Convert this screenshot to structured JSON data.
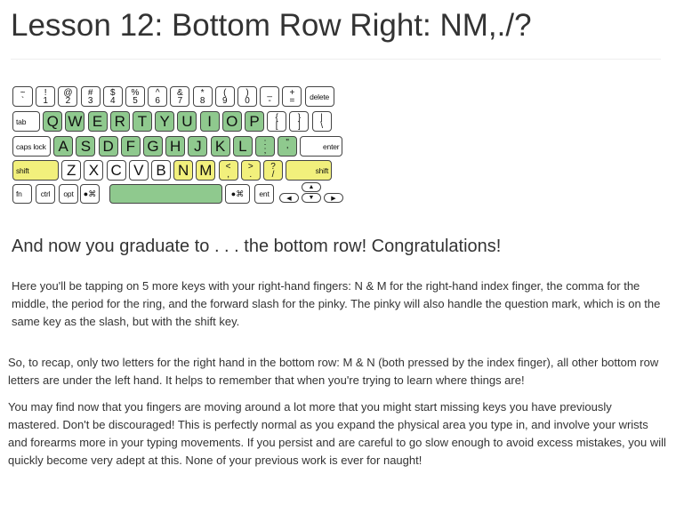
{
  "lesson": {
    "title": "Lesson 12: Bottom Row Right: NM,./?",
    "subheading": "And now you graduate to . . . the bottom row! Congratulations!",
    "paragraphs": [
      "Here you'll be tapping on 5 more keys with your right-hand fingers: N & M for the right-hand index finger, the comma for the middle, the period for the ring, and the forward slash for the pinky. The pinky will also handle the question mark, which is on the same key as the slash, but with the shift key.",
      "So, to recap, only two letters for the right hand in the bottom row: M & N (both pressed by the index finger), all other bottom row letters are under the left hand. It helps to remember that when you're trying to learn where things are!",
      "You may find now that you fingers are moving around a lot more that you might start missing keys you have previously mastered. Don't be discouraged! This is perfectly normal as you expand the physical area you type in, and involve your wrists and forearms more in your typing movements. If you persist and are careful to go slow enough to avoid excess mistakes, you will quickly become very adept at this. None of your previous work is ever for naught!"
    ]
  },
  "keyboard": {
    "colors": {
      "home_row": "#8fc98e",
      "lesson_keys": "#f2f07c",
      "unlearned": "#ffffff"
    },
    "rows": [
      [
        {
          "top": "~",
          "bottom": "`",
          "state": "unlearned"
        },
        {
          "top": "!",
          "bottom": "1",
          "state": "unlearned"
        },
        {
          "top": "@",
          "bottom": "2",
          "state": "unlearned"
        },
        {
          "top": "#",
          "bottom": "3",
          "state": "unlearned"
        },
        {
          "top": "$",
          "bottom": "4",
          "state": "unlearned"
        },
        {
          "top": "%",
          "bottom": "5",
          "state": "unlearned"
        },
        {
          "top": "^",
          "bottom": "6",
          "state": "unlearned"
        },
        {
          "top": "&",
          "bottom": "7",
          "state": "unlearned"
        },
        {
          "top": "*",
          "bottom": "8",
          "state": "unlearned"
        },
        {
          "top": "(",
          "bottom": "9",
          "state": "unlearned"
        },
        {
          "top": ")",
          "bottom": "0",
          "state": "unlearned"
        },
        {
          "top": "_",
          "bottom": "-",
          "state": "unlearned"
        },
        {
          "top": "+",
          "bottom": "=",
          "state": "unlearned"
        },
        {
          "label": "delete",
          "state": "unlearned"
        }
      ],
      [
        {
          "label": "tab",
          "state": "unlearned"
        },
        {
          "label": "Q",
          "state": "home"
        },
        {
          "label": "W",
          "state": "home"
        },
        {
          "label": "E",
          "state": "home"
        },
        {
          "label": "R",
          "state": "home"
        },
        {
          "label": "T",
          "state": "home"
        },
        {
          "label": "Y",
          "state": "home"
        },
        {
          "label": "U",
          "state": "home"
        },
        {
          "label": "I",
          "state": "home"
        },
        {
          "label": "O",
          "state": "home"
        },
        {
          "label": "P",
          "state": "home"
        },
        {
          "top": "{",
          "bottom": "[",
          "state": "unlearned"
        },
        {
          "top": "}",
          "bottom": "]",
          "state": "unlearned"
        },
        {
          "top": "|",
          "bottom": "\\",
          "state": "unlearned"
        }
      ],
      [
        {
          "label": "caps lock",
          "state": "unlearned"
        },
        {
          "label": "A",
          "state": "home"
        },
        {
          "label": "S",
          "state": "home"
        },
        {
          "label": "D",
          "state": "home"
        },
        {
          "label": "F",
          "state": "home"
        },
        {
          "label": "G",
          "state": "home"
        },
        {
          "label": "H",
          "state": "home"
        },
        {
          "label": "J",
          "state": "home"
        },
        {
          "label": "K",
          "state": "home"
        },
        {
          "label": "L",
          "state": "home"
        },
        {
          "top": ":",
          "bottom": ";",
          "state": "home"
        },
        {
          "top": "\"",
          "bottom": "'",
          "state": "home"
        },
        {
          "label": "enter",
          "state": "unlearned"
        }
      ],
      [
        {
          "label": "shift",
          "state": "lesson"
        },
        {
          "label": "Z",
          "state": "unlearned"
        },
        {
          "label": "X",
          "state": "unlearned"
        },
        {
          "label": "C",
          "state": "unlearned"
        },
        {
          "label": "V",
          "state": "unlearned"
        },
        {
          "label": "B",
          "state": "unlearned"
        },
        {
          "label": "N",
          "state": "lesson"
        },
        {
          "label": "M",
          "state": "lesson"
        },
        {
          "top": "<",
          "bottom": ",",
          "state": "lesson"
        },
        {
          "top": ">",
          "bottom": ".",
          "state": "lesson"
        },
        {
          "top": "?",
          "bottom": "/",
          "state": "lesson"
        },
        {
          "label": "shift",
          "state": "lesson"
        }
      ],
      [
        {
          "label": "fn",
          "state": "unlearned"
        },
        {
          "label": "ctrl",
          "state": "unlearned"
        },
        {
          "label": "opt",
          "state": "unlearned"
        },
        {
          "icon": "apple-command-icon",
          "state": "unlearned"
        },
        {
          "icon": "space-bar",
          "state": "home"
        },
        {
          "icon": "apple-command-icon",
          "state": "unlearned"
        },
        {
          "label": "ent",
          "state": "unlearned"
        },
        {
          "icon": "arrow-left-icon",
          "state": "unlearned"
        },
        {
          "icon": "arrow-up-icon",
          "state": "unlearned"
        },
        {
          "icon": "arrow-down-icon",
          "state": "unlearned"
        },
        {
          "icon": "arrow-right-icon",
          "state": "unlearned"
        }
      ]
    ]
  }
}
